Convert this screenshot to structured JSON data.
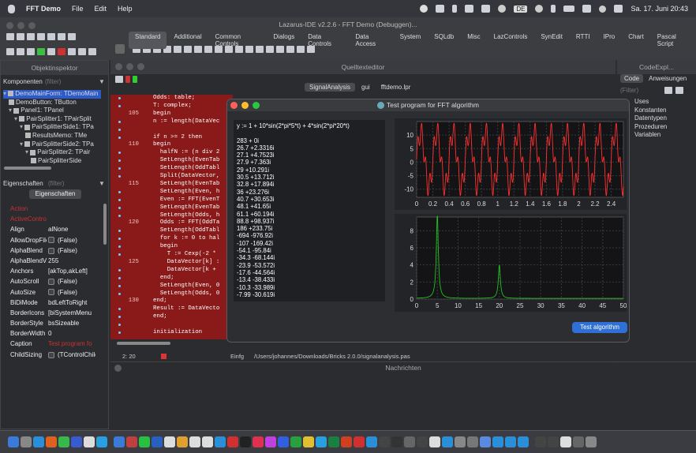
{
  "menubar": {
    "app_name": "FFT Demo",
    "menus": [
      "File",
      "Edit",
      "Help"
    ],
    "kbd": "DE",
    "datetime": "Sa. 17. Juni 20:43"
  },
  "ide": {
    "title": "Lazarus-IDE v2.2.6 - FFT Demo (Debuggen)...",
    "palette_tabs": [
      "Standard",
      "Additional",
      "Common Controls",
      "Dialogs",
      "Data Controls",
      "Data Access",
      "System",
      "SQLdb",
      "Misc",
      "LazControls",
      "SynEdit",
      "RTTI",
      "IPro",
      "Chart",
      "Pascal Script"
    ],
    "active_tab": "Standard"
  },
  "inspector": {
    "title": "Objektinspektor",
    "components_label": "Komponenten",
    "filter_placeholder": "(filter)",
    "tree": [
      "DemoMainForm: TDemoMain",
      "DemoButton: TButton",
      "Panel1: TPanel",
      "PairSplitter1: TPairSplit",
      "PairSplitterSide1: TPa",
      "ResultsMemo: TMe",
      "PairSplitterSide2: TPa",
      "PairSplitter2: TPair",
      "PairSplitterSide"
    ],
    "props_label": "Eigenschaften",
    "props_tab": "Eigenschaften",
    "props": [
      {
        "k": "Action",
        "v": ""
      },
      {
        "k": "ActiveControl",
        "v": ""
      },
      {
        "k": "Align",
        "v": "alNone"
      },
      {
        "k": "AllowDropFiles",
        "v": "(False)"
      },
      {
        "k": "AlphaBlend",
        "v": "(False)"
      },
      {
        "k": "AlphaBlendValu",
        "v": "255"
      },
      {
        "k": "Anchors",
        "v": "[akTop,akLeft]"
      },
      {
        "k": "AutoScroll",
        "v": "(False)"
      },
      {
        "k": "AutoSize",
        "v": "(False)"
      },
      {
        "k": "BiDiMode",
        "v": "bdLeftToRight"
      },
      {
        "k": "BorderIcons",
        "v": "[biSystemMenu"
      },
      {
        "k": "BorderStyle",
        "v": "bsSizeable"
      },
      {
        "k": "BorderWidth",
        "v": "0"
      },
      {
        "k": "Caption",
        "v": "Test program fo"
      },
      {
        "k": "ChildSizing",
        "v": "(TControlChildS"
      }
    ]
  },
  "source_editor": {
    "title": "Quelltexteditor",
    "tabs": [
      "SignalAnalysis",
      "gui",
      "fftdemo.lpr"
    ],
    "active_tab": "SignalAnalysis",
    "lines": [
      {
        "n": "",
        "t": "Odds: table;"
      },
      {
        "n": "",
        "t": "T: complex;"
      },
      {
        "n": "105",
        "t": "begin"
      },
      {
        "n": "",
        "t": "n := length(DataVec"
      },
      {
        "n": "",
        "t": ""
      },
      {
        "n": "",
        "t": "if n >= 2 then"
      },
      {
        "n": "110",
        "t": "begin"
      },
      {
        "n": "",
        "t": "  halfN := (n div 2"
      },
      {
        "n": "",
        "t": "  SetLength(EvenTab"
      },
      {
        "n": "",
        "t": "  SetLength(OddTabl"
      },
      {
        "n": "",
        "t": "  Split(DataVector,"
      },
      {
        "n": "115",
        "t": "  SetLength(EvenTab"
      },
      {
        "n": "",
        "t": "  SetLength(Even, h"
      },
      {
        "n": "",
        "t": "  Even := FFT(EvenT"
      },
      {
        "n": "",
        "t": "  SetLength(EvenTab"
      },
      {
        "n": "",
        "t": "  SetLength(Odds, h"
      },
      {
        "n": "120",
        "t": "  Odds := FFT(OddTa"
      },
      {
        "n": "",
        "t": "  SetLength(OddTabl"
      },
      {
        "n": "",
        "t": "  for k := 0 to hal"
      },
      {
        "n": "",
        "t": "  begin"
      },
      {
        "n": "",
        "t": "    T := Cexp(-2 *"
      },
      {
        "n": "125",
        "t": "    DataVector[k] :"
      },
      {
        "n": "",
        "t": "    DataVector[k +"
      },
      {
        "n": "",
        "t": "  end;"
      },
      {
        "n": "",
        "t": "  SetLength(Even, 0"
      },
      {
        "n": "",
        "t": "  SetLength(Odds, 0"
      },
      {
        "n": "130",
        "t": "end;"
      },
      {
        "n": "",
        "t": "Result := DataVecto"
      },
      {
        "n": "",
        "t": "end;"
      },
      {
        "n": "",
        "t": ""
      },
      {
        "n": "",
        "t": "initialization"
      }
    ],
    "status_pos": "2: 20",
    "status_mode": "Einfg",
    "status_path": "/Users/johannes/Downloads/Bricks 2.0.0/signalanalysis.pas"
  },
  "fft_window": {
    "title": "Test program for FFT algorithm",
    "formula": "y := 1 + 10*sin(2*pi*5*t) + 4*sin(2*pi*20*t)",
    "results": [
      "283 + 0i",
      "26.7 +2.3316i",
      "27.1 +4.7523i",
      "27.9 +7.363i",
      "29 +10.291i",
      "30.5 +13.712i",
      "32.8 +17.894i",
      "36 +23.276i",
      "40.7 +30.653i",
      "48.1 +41.65i",
      "61.1 +60.194i",
      "88.8 +98.937i",
      "186 +233.75i",
      "-694 -976.92i",
      "-107 -169.42i",
      "-54.1 -95.84i",
      "-34.3 -68.144i",
      "-23.9 -53.572i",
      "-17.6 -44.564i",
      "-13.4 -38.433i",
      "-10.3 -33.989i",
      "-7.99 -30.619i"
    ],
    "button": "Test algorithm"
  },
  "code_explorer": {
    "title": "CodeExpl...",
    "tabs": [
      "Code",
      "Anweisungen"
    ],
    "filter_placeholder": "(Filter)",
    "items": [
      "Uses",
      "Konstanten",
      "Datentypen",
      "Prozeduren",
      "Variablen"
    ]
  },
  "messages": {
    "title": "Nachrichten"
  },
  "chart_data": [
    {
      "type": "line",
      "x_ticks": [
        "0",
        "0.2",
        "0.4",
        "0.6",
        "0.8",
        "1",
        "1.2",
        "1.4",
        "1.6",
        "1.8",
        "2",
        "2.2",
        "2.4"
      ],
      "y_ticks": [
        "10",
        "5",
        "0",
        "-5",
        "-10"
      ],
      "xlim": [
        0,
        2.55
      ],
      "ylim": [
        -13,
        15
      ],
      "series": [
        {
          "color": "#ff3030",
          "formula": "1 + 10*sin(2*pi*5*t) + 4*sin(2*pi*20*t)"
        }
      ]
    },
    {
      "type": "line",
      "x_ticks": [
        "0",
        "5",
        "10",
        "15",
        "20",
        "25",
        "30",
        "35",
        "40",
        "45",
        "50"
      ],
      "y_ticks": [
        "8",
        "6",
        "4",
        "2",
        "0"
      ],
      "xlim": [
        0,
        50
      ],
      "ylim": [
        0,
        9.6
      ],
      "series": [
        {
          "color": "#22c022",
          "peaks": [
            {
              "x": 5,
              "y": 9.8
            },
            {
              "x": 20,
              "y": 3.9
            }
          ]
        }
      ]
    }
  ]
}
